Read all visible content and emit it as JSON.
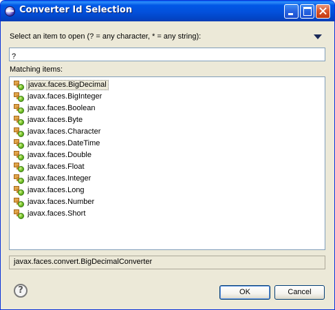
{
  "window": {
    "title": "Converter Id Selection"
  },
  "prompt": "Select an item to open (? = any character, * = any string):",
  "filter": {
    "value": "?"
  },
  "matching_label": "Matching items:",
  "items": [
    {
      "label": "javax.faces.BigDecimal",
      "selected": true
    },
    {
      "label": "javax.faces.BigInteger"
    },
    {
      "label": "javax.faces.Boolean"
    },
    {
      "label": "javax.faces.Byte"
    },
    {
      "label": "javax.faces.Character"
    },
    {
      "label": "javax.faces.DateTime"
    },
    {
      "label": "javax.faces.Double"
    },
    {
      "label": "javax.faces.Float"
    },
    {
      "label": "javax.faces.Integer"
    },
    {
      "label": "javax.faces.Long"
    },
    {
      "label": "javax.faces.Number"
    },
    {
      "label": "javax.faces.Short"
    }
  ],
  "item_icon": "converter-plug-icon",
  "status": "javax.faces.convert.BigDecimalConverter",
  "buttons": {
    "ok": "OK",
    "cancel": "Cancel",
    "help": "?"
  },
  "colors": {
    "titlebar": "#0058e6",
    "selection": "#316ac5",
    "dialog_bg": "#ece9d8"
  }
}
